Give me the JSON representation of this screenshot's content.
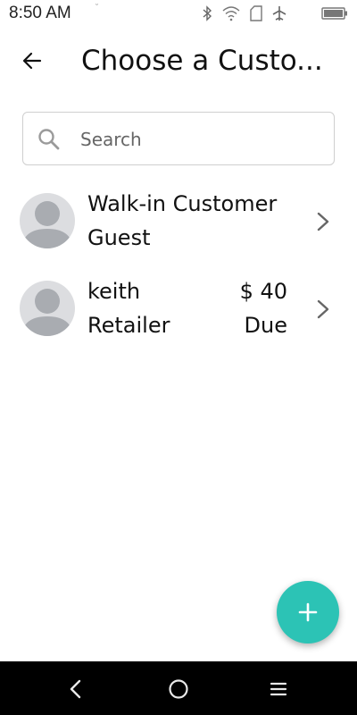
{
  "status_bar": {
    "time": "8:50 AM",
    "icons": [
      "bluetooth-icon",
      "wifi-icon",
      "sim-card-icon",
      "airplane-icon",
      "battery-icon"
    ]
  },
  "header": {
    "title": "Choose a Custo..."
  },
  "search": {
    "placeholder": "Search",
    "value": ""
  },
  "customers": [
    {
      "name": "Walk-in Customer",
      "type": "Guest",
      "amount": "",
      "status": ""
    },
    {
      "name": "keith",
      "type": "Retailer",
      "amount": "$ 40",
      "status": "Due"
    }
  ],
  "colors": {
    "accent": "#2cc3b5",
    "avatar_bg": "#dcdde0",
    "avatar_fg": "#a9acb1"
  },
  "fab": {
    "icon": "plus-icon"
  },
  "nav_bar": {
    "icons": [
      "back-triangle-icon",
      "home-circle-icon",
      "menu-icon"
    ]
  }
}
